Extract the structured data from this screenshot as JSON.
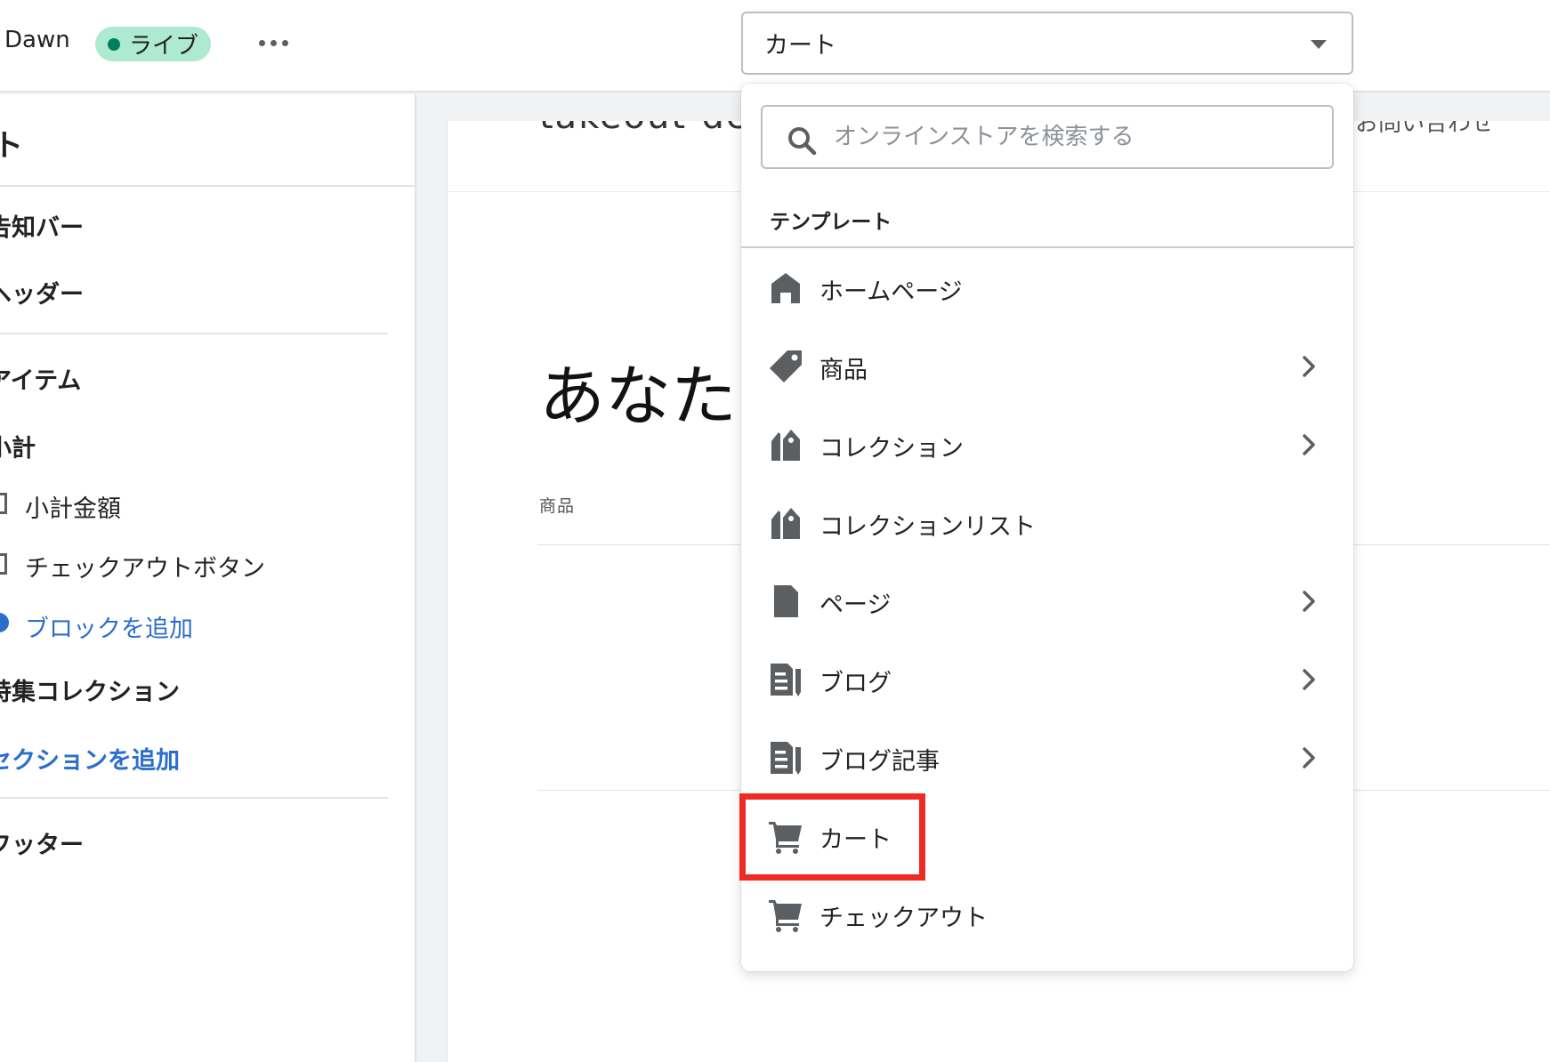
{
  "topbar": {
    "theme_name": "Dawn",
    "status_badge": "ライブ",
    "more_label": "•••",
    "template_select": {
      "value": "カート"
    }
  },
  "sidebar": {
    "title": "ト",
    "items": [
      {
        "label": "告知バー"
      },
      {
        "label": "ヘッダー"
      },
      {
        "label": "アイテム"
      },
      {
        "label": "小計"
      },
      {
        "label": "小計金額"
      },
      {
        "label": "チェックアウトボタン"
      },
      {
        "label": "ブロックを追加"
      },
      {
        "label": "特集コレクション"
      },
      {
        "label": "セクションを追加"
      },
      {
        "label": "フッター"
      }
    ]
  },
  "preview": {
    "logo": "takeout-de",
    "header_right": "お問い合わせ",
    "heading": "あなた",
    "column_product": "商品"
  },
  "dropdown": {
    "search": {
      "placeholder": "オンラインストアを検索する",
      "value": ""
    },
    "section_title": "テンプレート",
    "items": [
      {
        "label": "ホームページ",
        "icon": "home-icon",
        "has_children": false
      },
      {
        "label": "商品",
        "icon": "tag-icon",
        "has_children": true
      },
      {
        "label": "コレクション",
        "icon": "collection-icon",
        "has_children": true
      },
      {
        "label": "コレクションリスト",
        "icon": "collection-icon",
        "has_children": false
      },
      {
        "label": "ページ",
        "icon": "page-icon",
        "has_children": true
      },
      {
        "label": "ブログ",
        "icon": "blog-icon",
        "has_children": true
      },
      {
        "label": "ブログ記事",
        "icon": "blog-icon",
        "has_children": true
      },
      {
        "label": "カート",
        "icon": "cart-icon",
        "has_children": false,
        "highlighted": true
      },
      {
        "label": "チェックアウト",
        "icon": "cart-icon",
        "has_children": false
      }
    ]
  },
  "colors": {
    "accent_link": "#2c6ecb",
    "live_badge_bg": "#aee9d1",
    "live_dot": "#007f5f",
    "highlight_border": "#f02a24",
    "icon_gray": "#5c5f62"
  }
}
